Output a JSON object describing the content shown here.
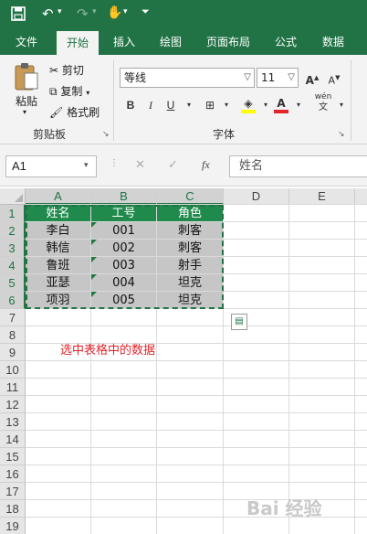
{
  "qat": {
    "save_icon": "save-icon",
    "undo_icon": "undo-icon",
    "redo_icon": "redo-icon",
    "touch_icon": "touch-mode-icon",
    "customize_icon": "customize-qat-icon"
  },
  "tabs": [
    {
      "label": "文件",
      "active": false
    },
    {
      "label": "开始",
      "active": true
    },
    {
      "label": "插入",
      "active": false
    },
    {
      "label": "绘图",
      "active": false
    },
    {
      "label": "页面布局",
      "active": false
    },
    {
      "label": "公式",
      "active": false
    },
    {
      "label": "数据",
      "active": false
    }
  ],
  "clipboard": {
    "paste": "粘贴",
    "cut": "剪切",
    "copy": "复制",
    "format_painter": "格式刷",
    "group": "剪贴板"
  },
  "font": {
    "name": "等线",
    "size": "11",
    "group": "字体",
    "bold": "B",
    "italic": "I",
    "underline": "U",
    "grow": "A",
    "shrink": "A",
    "font_color": "A",
    "phonetic": "wén"
  },
  "formula": {
    "namebox": "A1",
    "cancel": "✕",
    "enter": "✓",
    "fx": "fx",
    "value": "姓名"
  },
  "columns": [
    "A",
    "B",
    "C",
    "D",
    "E"
  ],
  "rows": [
    "1",
    "2",
    "3",
    "4",
    "5",
    "6",
    "7",
    "8",
    "9",
    "10",
    "11",
    "12",
    "13",
    "14",
    "15",
    "16",
    "17",
    "18",
    "19"
  ],
  "table": {
    "headers": [
      "姓名",
      "工号",
      "角色"
    ],
    "rows": [
      [
        "李白",
        "001",
        "刺客"
      ],
      [
        "韩信",
        "002",
        "刺客"
      ],
      [
        "鲁班",
        "003",
        "射手"
      ],
      [
        "亚瑟",
        "004",
        "坦克"
      ],
      [
        "项羽",
        "005",
        "坦克"
      ]
    ]
  },
  "annotation": "选中表格中的数据",
  "watermark": "Bai 经验",
  "colors": {
    "excel_green": "#217346",
    "header_fill": "#1f8a4c",
    "selection_fill": "#c6c6c6",
    "annotation": "#e0242a"
  }
}
